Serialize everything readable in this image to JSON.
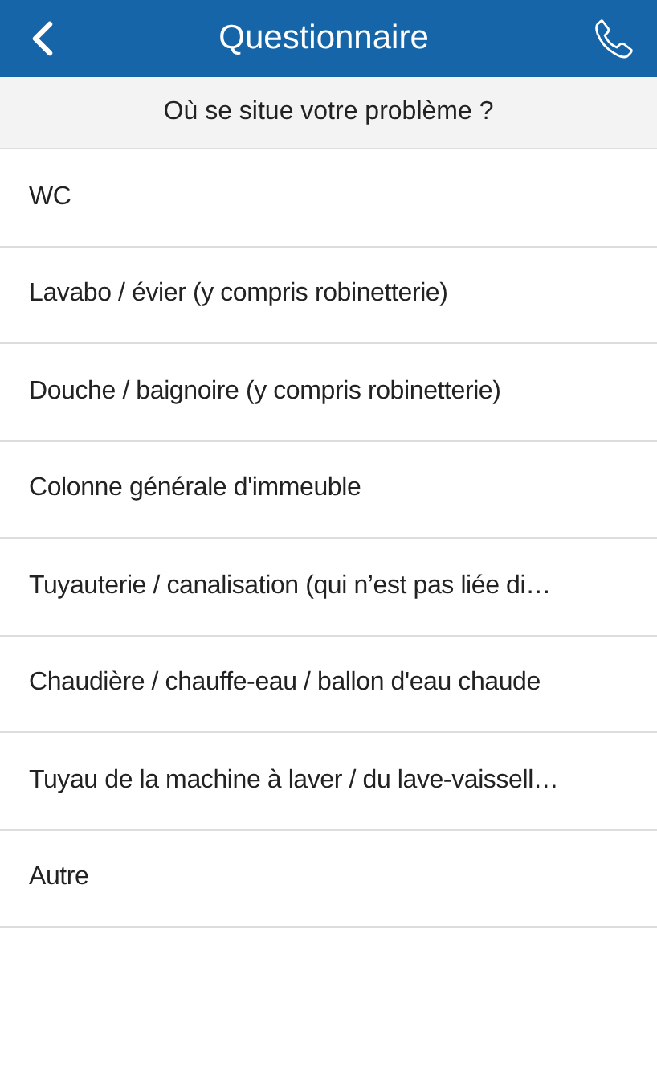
{
  "header": {
    "title": "Questionnaire"
  },
  "question": "Où se situe votre problème ?",
  "options": [
    {
      "label": "WC"
    },
    {
      "label": "Lavabo / évier (y compris robinetterie)"
    },
    {
      "label": "Douche / baignoire (y compris robinetterie)"
    },
    {
      "label": "Colonne générale d'immeuble"
    },
    {
      "label": "Tuyauterie / canalisation (qui n’est pas liée di…"
    },
    {
      "label": "Chaudière / chauffe-eau / ballon d'eau chaude"
    },
    {
      "label": "Tuyau de la machine à laver / du lave-vaissell…"
    },
    {
      "label": "Autre"
    }
  ]
}
